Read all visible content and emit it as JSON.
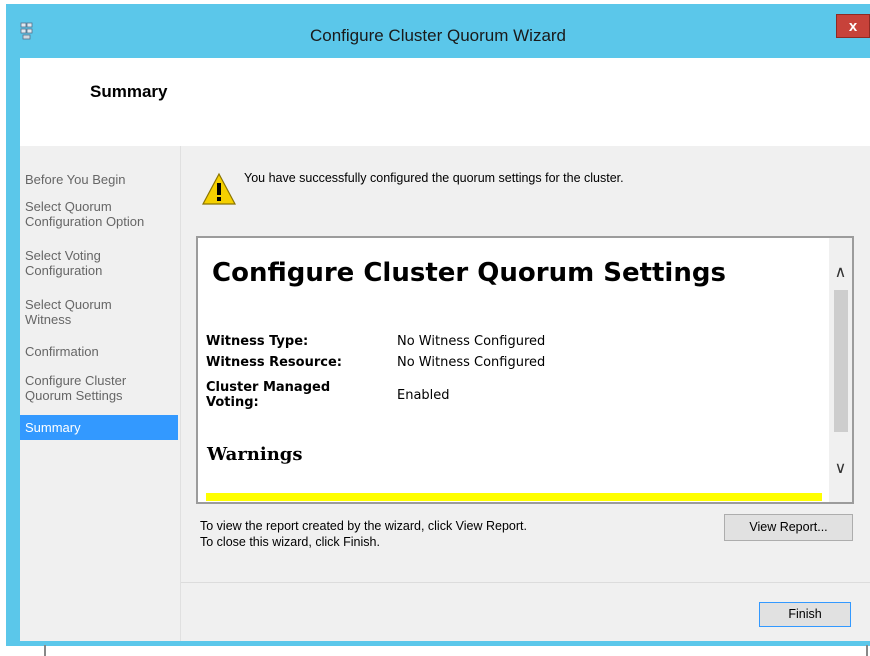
{
  "window": {
    "title": "Configure Cluster Quorum Wizard",
    "close_label": "x",
    "accent_color": "#5bc7ea"
  },
  "header": {
    "title": "Summary"
  },
  "sidebar": {
    "items": [
      {
        "label": "Before You Begin",
        "active": false
      },
      {
        "label": "Select Quorum\nConfiguration Option",
        "active": false
      },
      {
        "label": "Select Voting\nConfiguration",
        "active": false
      },
      {
        "label": "Select Quorum\nWitness",
        "active": false
      },
      {
        "label": "Confirmation",
        "active": false
      },
      {
        "label": "Configure Cluster\nQuorum Settings",
        "active": false
      },
      {
        "label": "Summary",
        "active": true
      }
    ]
  },
  "main": {
    "icon": "warning-icon",
    "message": "You have successfully configured the quorum settings for the cluster.",
    "report": {
      "title": "Configure Cluster Quorum Settings",
      "rows": [
        {
          "label": "Witness Type:",
          "value": "No Witness Configured"
        },
        {
          "label": "Witness Resource:",
          "value": "No Witness Configured"
        },
        {
          "label": "Cluster Managed\nVoting:",
          "value": "Enabled"
        }
      ],
      "warnings_heading": "Warnings"
    },
    "info_line1": "To view the report created by the wizard, click View Report.",
    "info_line2": "To close this wizard, click Finish.",
    "view_report_label": "View Report...",
    "finish_label": "Finish"
  }
}
